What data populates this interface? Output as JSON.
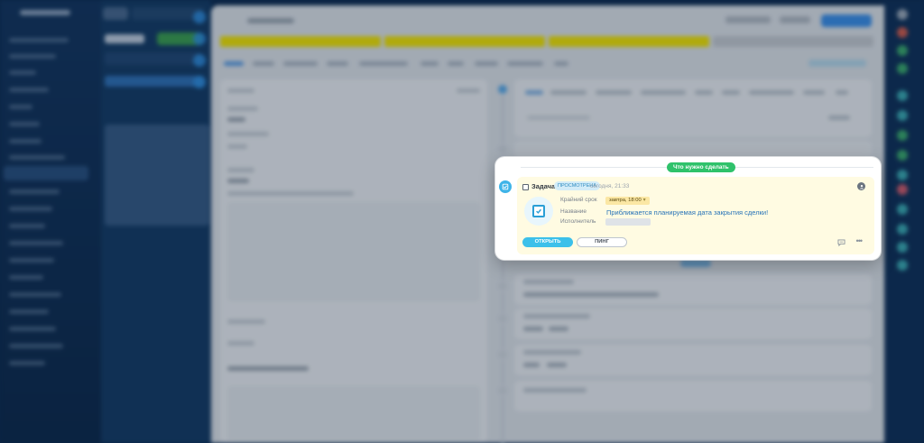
{
  "colors": {
    "accent_blue": "#3cc0ea",
    "section_badge_green": "#2fc26b",
    "status_badge_bg": "#d3ecf8",
    "deadline_chip_bg": "#fbe7a4",
    "task_card_bg": "#fffbe2",
    "task_link": "#2874b8",
    "stage_yellow": "#f2e200",
    "stage_grey": "#c5c9ce"
  },
  "timeline_section": {
    "label": "Что нужно сделать"
  },
  "task": {
    "type_label": "Задача",
    "status": "просмотрена",
    "time": "сегодня, 21:33",
    "deadline_label": "Крайний срок",
    "deadline_value": "завтра, 18:00",
    "name_label": "Название",
    "name_value": "Приближается планируемая дата закрытия сделки!",
    "assignee_label": "Исполнитель",
    "open_label": "Открыть",
    "ping_label": "Пинг"
  },
  "icons": {
    "timeline": "task-check-icon",
    "author": "user-avatar-icon",
    "task": "task-checkbox-icon",
    "comment": "comment-icon",
    "more": "more-dots-icon"
  }
}
